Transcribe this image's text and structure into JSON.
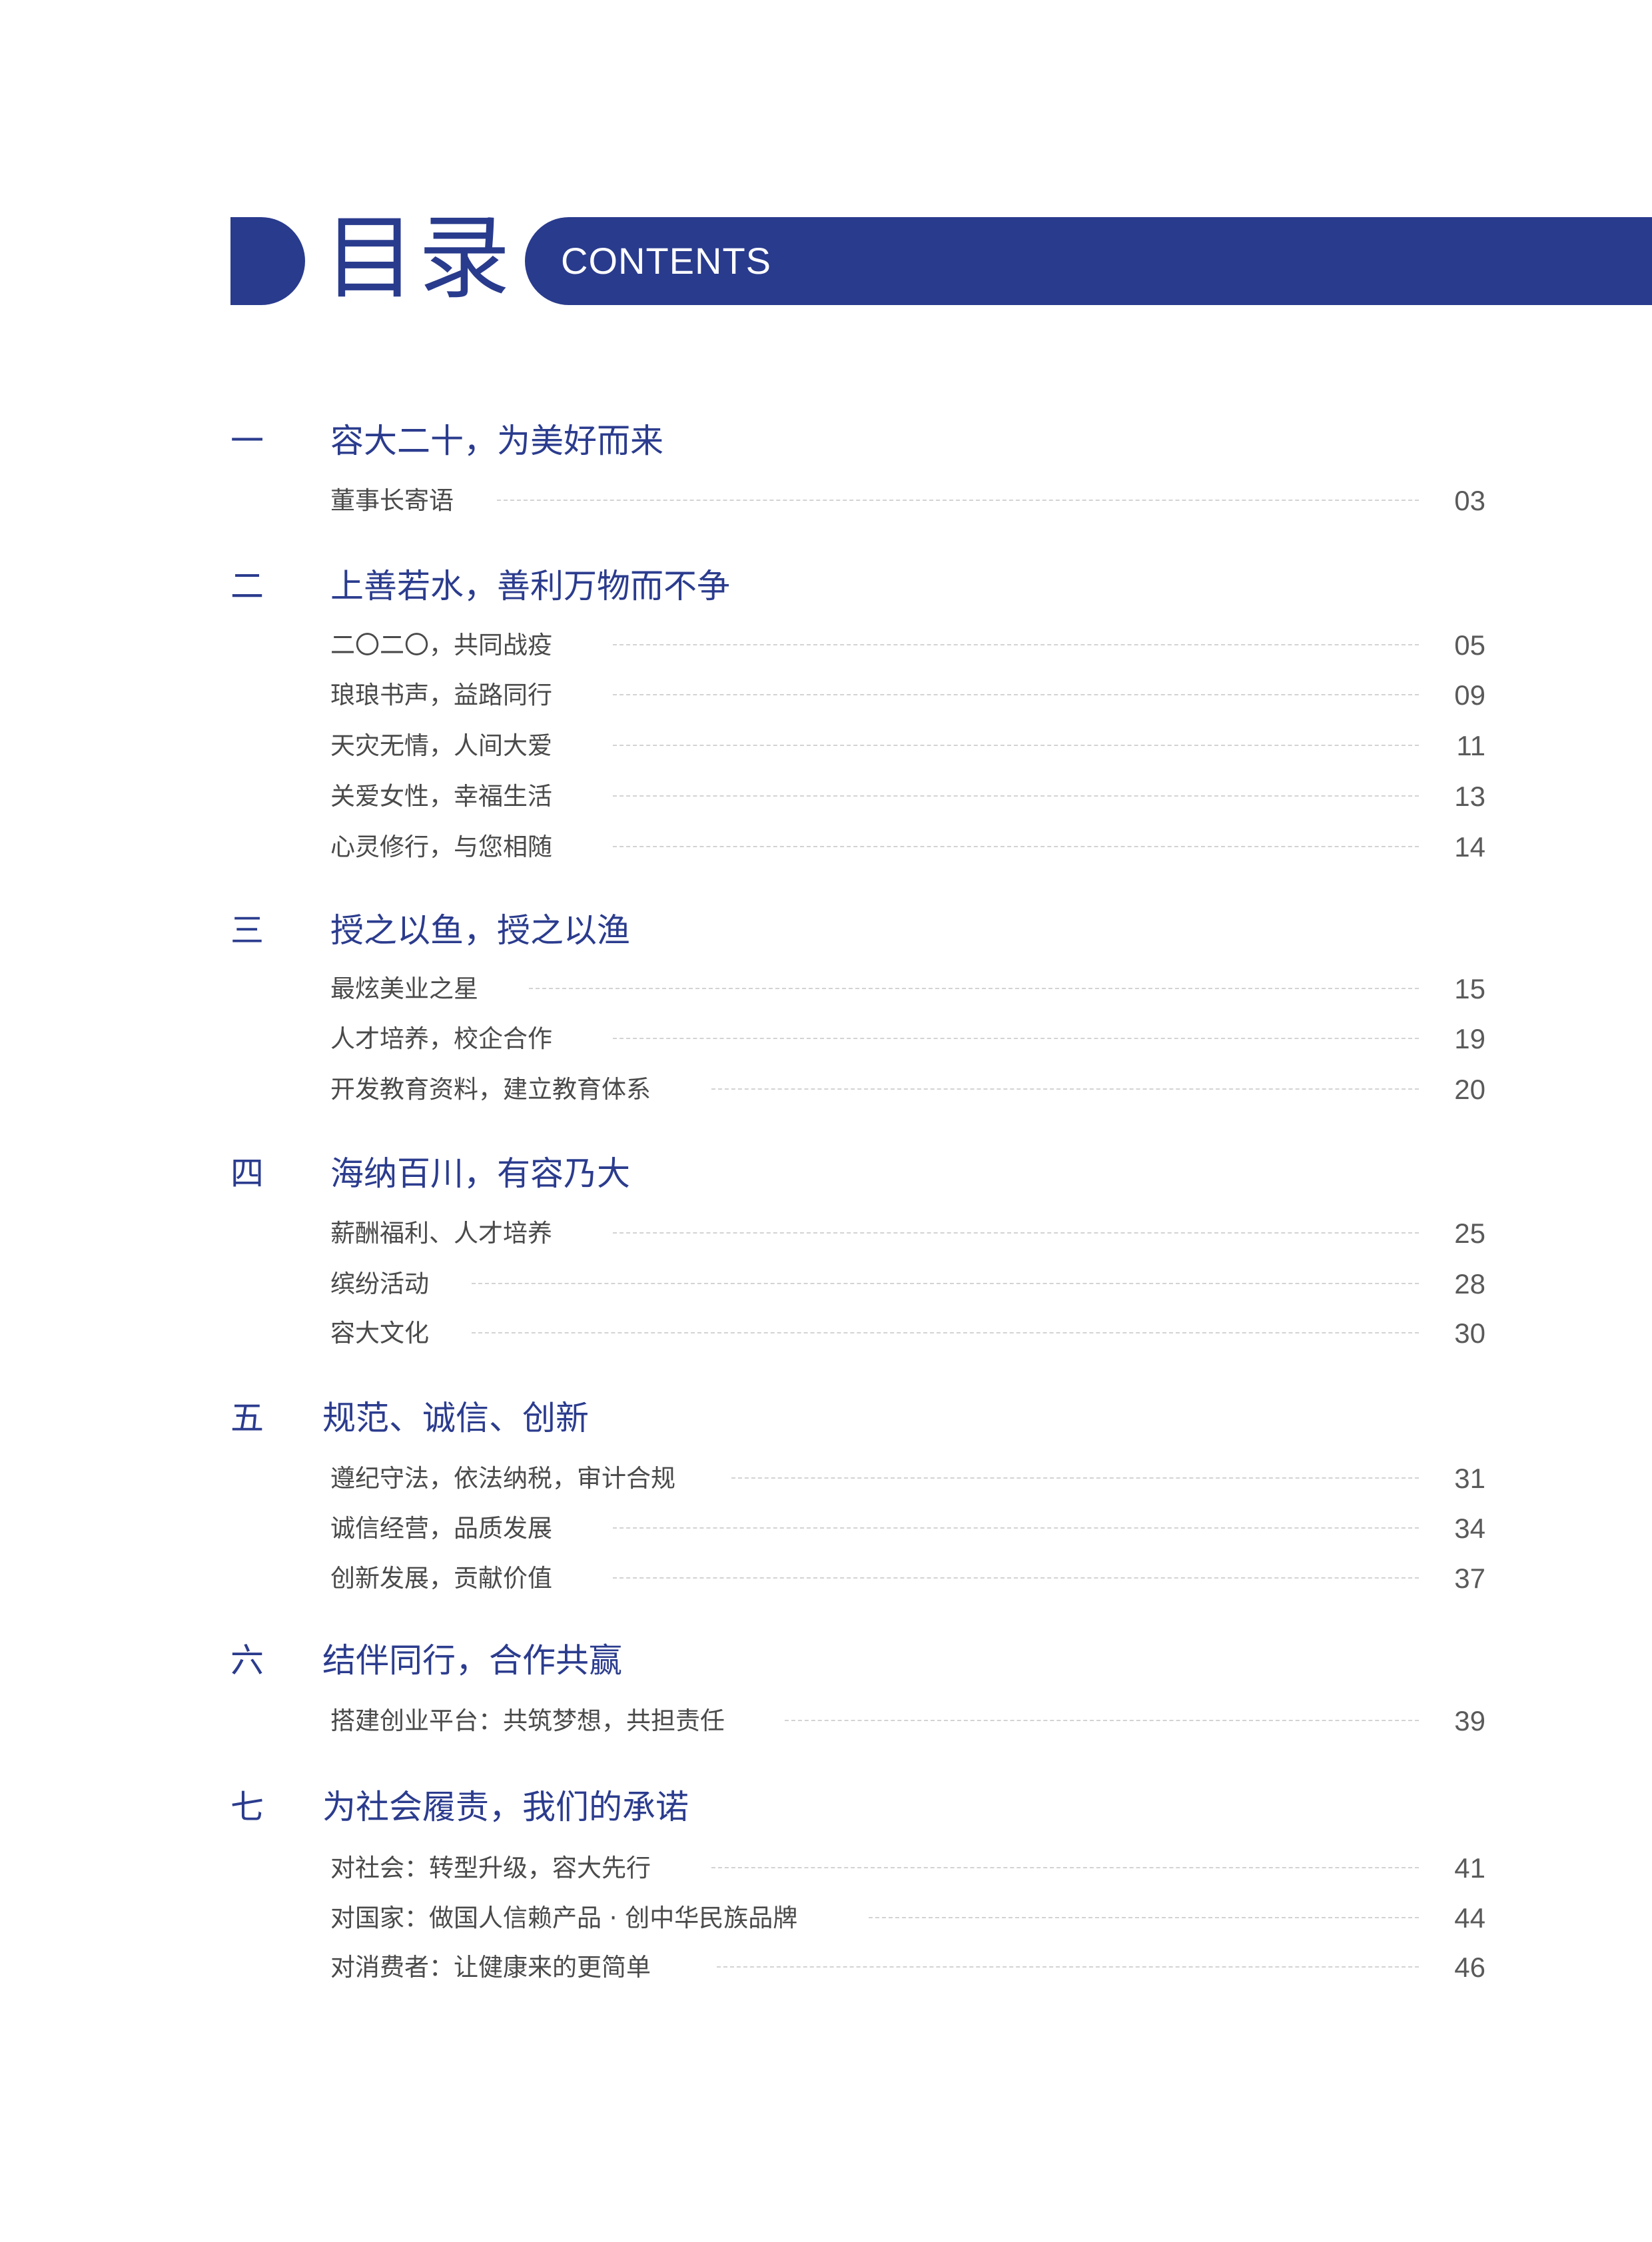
{
  "header": {
    "title": "目录",
    "subtitle": "CONTENTS",
    "accent_color": "#293b8d"
  },
  "sections": [
    {
      "number": "一",
      "title": "容大二十，为美好而来",
      "entries": [
        {
          "label": "董事长寄语",
          "page": "03"
        }
      ]
    },
    {
      "number": "二",
      "title": "上善若水，善利万物而不争",
      "entries": [
        {
          "label": "二〇二〇，共同战疫",
          "page": "05"
        },
        {
          "label": "琅琅书声，益路同行",
          "page": "09"
        },
        {
          "label": "天灾无情，人间大爱",
          "page": "11"
        },
        {
          "label": "关爱女性，幸福生活",
          "page": "13"
        },
        {
          "label": "心灵修行，与您相随",
          "page": "14"
        }
      ]
    },
    {
      "number": "三",
      "title": "授之以鱼，授之以渔",
      "entries": [
        {
          "label": "最炫美业之星",
          "page": "15"
        },
        {
          "label": "人才培养，校企合作",
          "page": "19"
        },
        {
          "label": "开发教育资料，建立教育体系",
          "page": "20"
        }
      ]
    },
    {
      "number": "四",
      "title": "海纳百川，有容乃大",
      "entries": [
        {
          "label": "薪酬福利、人才培养",
          "page": "25"
        },
        {
          "label": "缤纷活动",
          "page": "28"
        },
        {
          "label": "容大文化",
          "page": "30"
        }
      ]
    },
    {
      "number": "五",
      "title": "规范、诚信、创新",
      "entries": [
        {
          "label": "遵纪守法，依法纳税，审计合规",
          "page": "31"
        },
        {
          "label": "诚信经营，品质发展",
          "page": "34"
        },
        {
          "label": "创新发展，贡献价值",
          "page": "37"
        }
      ]
    },
    {
      "number": "六",
      "title": "结伴同行，合作共赢",
      "entries": [
        {
          "label": "搭建创业平台：共筑梦想，共担责任",
          "page": "39"
        }
      ]
    },
    {
      "number": "七",
      "title": "为社会履责，我们的承诺",
      "entries": [
        {
          "label": "对社会：转型升级，容大先行",
          "page": "41"
        },
        {
          "label": "对国家：做国人信赖产品 · 创中华民族品牌",
          "page": "44"
        },
        {
          "label": "对消费者：让健康来的更简单",
          "page": "46"
        }
      ]
    }
  ]
}
